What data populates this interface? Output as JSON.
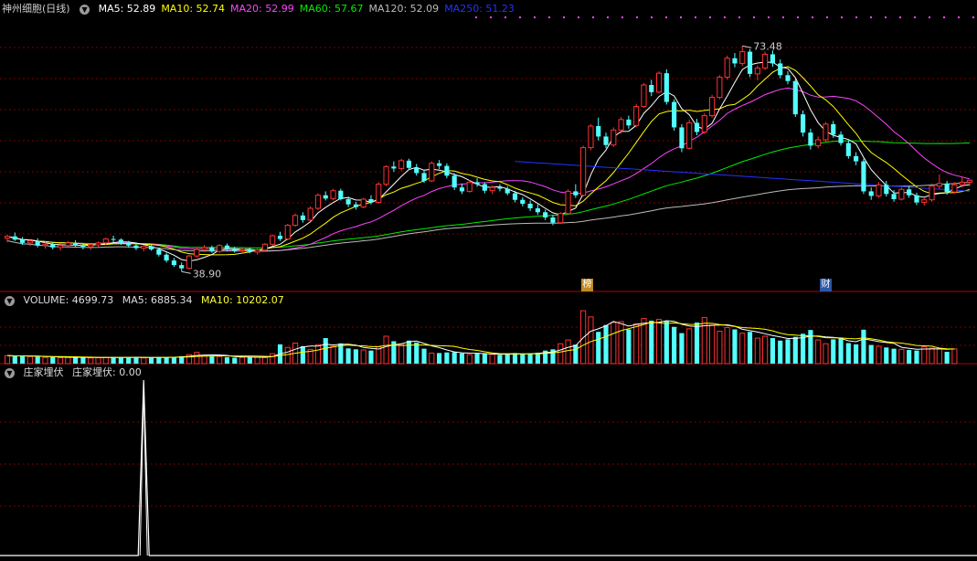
{
  "panel1": {
    "title": "神州细胞(日线)",
    "ma_labels": [
      {
        "text": "MA5: 52.89",
        "color": "#ffffff"
      },
      {
        "text": "MA10: 52.74",
        "color": "#ffff00"
      },
      {
        "text": "MA20: 52.99",
        "color": "#ff44ff"
      },
      {
        "text": "MA60: 57.67",
        "color": "#00ee00"
      },
      {
        "text": "MA120: 52.09",
        "color": "#bbbbbb"
      },
      {
        "text": "MA250: 51.23",
        "color": "#2233ff"
      }
    ],
    "high_label": "73.48",
    "low_label": "38.90",
    "marker_bang": "榜",
    "marker_cai": "财"
  },
  "panel2": {
    "title": "VOLUME: 4699.73",
    "ma5": "MA5: 6885.34",
    "ma10": "MA10: 10202.07"
  },
  "panel3": {
    "title": "庄家埋伏",
    "value_label": "庄家埋伏: 0.00"
  },
  "colors": {
    "up": "#ff3232",
    "down": "#54ffff",
    "grid": "#7a0000",
    "panel_border": "#b00000"
  },
  "icons": [
    "collapse-arrow-icon"
  ],
  "chart_data": [
    {
      "type": "candlestick",
      "title": "神州细胞(日线)",
      "ylim": [
        36,
        78
      ],
      "annotations": [
        {
          "text": "73.48",
          "value": 73.48
        },
        {
          "text": "38.90",
          "value": 38.9
        }
      ],
      "series": [
        {
          "name": "MA5",
          "value": 52.89
        },
        {
          "name": "MA10",
          "value": 52.74
        },
        {
          "name": "MA20",
          "value": 52.99
        },
        {
          "name": "MA60",
          "value": 57.67
        },
        {
          "name": "MA120",
          "value": 52.09
        },
        {
          "name": "MA250",
          "value": 51.23
        }
      ],
      "candles": [
        [
          44.0,
          44.6,
          43.4,
          44.3
        ],
        [
          44.3,
          44.9,
          43.6,
          43.8
        ],
        [
          43.8,
          44.2,
          43.0,
          43.3
        ],
        [
          43.3,
          43.9,
          42.8,
          43.6
        ],
        [
          43.6,
          44.0,
          42.6,
          42.9
        ],
        [
          42.9,
          43.5,
          42.4,
          43.1
        ],
        [
          43.1,
          43.4,
          42.3,
          42.6
        ],
        [
          42.6,
          43.2,
          42.1,
          42.9
        ],
        [
          42.9,
          43.6,
          42.5,
          43.3
        ],
        [
          43.3,
          43.7,
          42.7,
          42.9
        ],
        [
          42.9,
          43.3,
          42.3,
          42.7
        ],
        [
          42.7,
          43.2,
          42.2,
          43.0
        ],
        [
          43.0,
          43.5,
          42.6,
          43.3
        ],
        [
          43.3,
          44.1,
          43.0,
          43.9
        ],
        [
          43.9,
          44.4,
          43.4,
          43.8
        ],
        [
          43.8,
          44.0,
          43.0,
          43.3
        ],
        [
          43.3,
          43.6,
          42.6,
          42.9
        ],
        [
          42.9,
          43.3,
          42.2,
          42.5
        ],
        [
          42.5,
          43.0,
          42.0,
          42.8
        ],
        [
          42.8,
          43.1,
          42.1,
          42.3
        ],
        [
          42.3,
          42.6,
          41.2,
          41.5
        ],
        [
          41.5,
          41.8,
          40.3,
          40.6
        ],
        [
          40.6,
          41.0,
          39.6,
          39.9
        ],
        [
          39.9,
          40.3,
          38.9,
          39.4
        ],
        [
          39.4,
          41.5,
          39.2,
          41.3
        ],
        [
          41.3,
          42.6,
          41.0,
          42.3
        ],
        [
          42.3,
          43.0,
          41.9,
          42.6
        ],
        [
          42.6,
          42.9,
          41.8,
          42.0
        ],
        [
          42.0,
          43.1,
          41.8,
          42.9
        ],
        [
          42.9,
          43.2,
          42.0,
          42.4
        ],
        [
          42.4,
          42.7,
          41.8,
          42.1
        ],
        [
          42.1,
          42.5,
          41.6,
          42.3
        ],
        [
          42.3,
          42.6,
          41.7,
          41.9
        ],
        [
          41.9,
          42.4,
          41.5,
          42.2
        ],
        [
          42.2,
          43.3,
          42.0,
          43.1
        ],
        [
          43.1,
          44.6,
          42.9,
          44.4
        ],
        [
          44.4,
          45.0,
          43.6,
          43.9
        ],
        [
          43.9,
          46.2,
          43.7,
          46.0
        ],
        [
          46.0,
          47.8,
          45.8,
          47.5
        ],
        [
          47.5,
          48.0,
          46.4,
          46.8
        ],
        [
          46.8,
          48.9,
          46.6,
          48.6
        ],
        [
          48.6,
          50.9,
          48.3,
          50.6
        ],
        [
          50.6,
          51.2,
          49.8,
          50.1
        ],
        [
          50.1,
          51.6,
          49.8,
          51.3
        ],
        [
          51.3,
          51.6,
          49.8,
          50.0
        ],
        [
          50.0,
          50.4,
          48.8,
          49.2
        ],
        [
          49.2,
          49.6,
          48.4,
          48.8
        ],
        [
          48.8,
          50.2,
          48.6,
          50.0
        ],
        [
          50.0,
          50.6,
          49.2,
          49.5
        ],
        [
          49.5,
          52.6,
          49.3,
          52.3
        ],
        [
          52.3,
          55.2,
          52.0,
          55.0
        ],
        [
          55.0,
          55.8,
          54.2,
          54.7
        ],
        [
          54.7,
          56.2,
          54.3,
          55.9
        ],
        [
          55.9,
          56.2,
          54.5,
          54.8
        ],
        [
          54.8,
          55.4,
          53.6,
          54.0
        ],
        [
          54.0,
          54.5,
          52.5,
          52.8
        ],
        [
          52.8,
          55.8,
          52.6,
          55.5
        ],
        [
          55.5,
          56.0,
          54.6,
          55.1
        ],
        [
          55.1,
          55.5,
          53.2,
          53.6
        ],
        [
          53.6,
          54.0,
          51.4,
          51.8
        ],
        [
          51.8,
          52.4,
          50.8,
          51.2
        ],
        [
          51.2,
          52.9,
          51.0,
          52.6
        ],
        [
          52.6,
          53.2,
          51.9,
          52.3
        ],
        [
          52.3,
          52.6,
          50.9,
          51.3
        ],
        [
          51.3,
          52.1,
          50.8,
          51.8
        ],
        [
          51.8,
          52.3,
          51.2,
          51.6
        ],
        [
          51.6,
          52.0,
          50.6,
          50.9
        ],
        [
          50.9,
          51.3,
          49.5,
          49.9
        ],
        [
          49.9,
          50.3,
          48.9,
          49.3
        ],
        [
          49.3,
          49.8,
          48.2,
          48.6
        ],
        [
          48.6,
          49.2,
          47.6,
          48.0
        ],
        [
          48.0,
          48.4,
          46.8,
          47.2
        ],
        [
          47.2,
          47.6,
          46.0,
          46.4
        ],
        [
          46.4,
          48.0,
          46.2,
          47.8
        ],
        [
          47.8,
          51.5,
          47.6,
          51.2
        ],
        [
          51.2,
          52.3,
          50.2,
          50.6
        ],
        [
          50.6,
          58.2,
          50.4,
          57.9
        ],
        [
          57.9,
          61.5,
          57.5,
          61.2
        ],
        [
          61.2,
          62.5,
          59.0,
          59.6
        ],
        [
          59.6,
          60.2,
          57.8,
          58.3
        ],
        [
          58.3,
          61.0,
          58.0,
          60.6
        ],
        [
          60.6,
          62.6,
          60.0,
          62.2
        ],
        [
          62.2,
          62.8,
          60.8,
          61.3
        ],
        [
          61.3,
          64.6,
          61.0,
          64.2
        ],
        [
          64.2,
          67.8,
          64.0,
          67.5
        ],
        [
          67.5,
          68.3,
          65.8,
          66.4
        ],
        [
          66.4,
          69.6,
          66.2,
          69.3
        ],
        [
          69.3,
          69.9,
          64.5,
          64.9
        ],
        [
          64.9,
          65.3,
          60.5,
          61.0
        ],
        [
          61.0,
          61.5,
          57.2,
          57.8
        ],
        [
          57.8,
          62.2,
          57.6,
          61.7
        ],
        [
          61.7,
          62.3,
          59.8,
          60.3
        ],
        [
          60.3,
          63.2,
          60.0,
          62.8
        ],
        [
          62.8,
          66.0,
          62.5,
          65.6
        ],
        [
          65.6,
          69.0,
          65.3,
          68.7
        ],
        [
          68.7,
          72.0,
          68.3,
          71.6
        ],
        [
          71.6,
          72.4,
          70.2,
          70.8
        ],
        [
          70.8,
          73.48,
          70.4,
          72.6
        ],
        [
          72.6,
          73.0,
          68.7,
          69.2
        ],
        [
          69.2,
          70.5,
          68.2,
          70.1
        ],
        [
          70.1,
          72.6,
          69.8,
          72.2
        ],
        [
          72.2,
          72.8,
          70.3,
          70.8
        ],
        [
          70.8,
          71.4,
          68.5,
          69.0
        ],
        [
          69.0,
          69.6,
          67.6,
          68.1
        ],
        [
          68.1,
          68.5,
          62.6,
          63.0
        ],
        [
          63.0,
          63.6,
          59.6,
          60.2
        ],
        [
          60.2,
          60.8,
          57.6,
          58.2
        ],
        [
          58.2,
          59.6,
          57.8,
          59.1
        ],
        [
          59.1,
          61.8,
          58.8,
          61.5
        ],
        [
          61.5,
          62.0,
          59.4,
          59.9
        ],
        [
          59.9,
          60.4,
          58.2,
          58.6
        ],
        [
          58.6,
          59.0,
          56.2,
          56.6
        ],
        [
          56.6,
          57.2,
          55.2,
          55.8
        ],
        [
          55.8,
          56.2,
          50.8,
          51.2
        ],
        [
          51.2,
          51.8,
          49.9,
          50.5
        ],
        [
          50.5,
          52.6,
          50.2,
          52.2
        ],
        [
          52.2,
          52.8,
          50.4,
          50.8
        ],
        [
          50.8,
          51.4,
          49.6,
          50.0
        ],
        [
          50.0,
          51.8,
          49.8,
          51.5
        ],
        [
          51.5,
          52.0,
          50.2,
          50.6
        ],
        [
          50.6,
          51.0,
          49.1,
          49.5
        ],
        [
          49.5,
          50.3,
          49.0,
          49.9
        ],
        [
          49.9,
          52.4,
          49.6,
          52.0
        ],
        [
          52.0,
          53.8,
          51.6,
          52.4
        ],
        [
          52.4,
          52.8,
          50.7,
          51.1
        ],
        [
          51.1,
          52.6,
          50.9,
          52.2
        ],
        [
          52.2,
          53.4,
          51.8,
          52.6
        ],
        [
          52.6,
          53.0,
          52.0,
          52.9
        ]
      ],
      "volume": [
        2600,
        2400,
        2500,
        2300,
        2200,
        2000,
        2100,
        1900,
        2000,
        2100,
        1950,
        1850,
        1900,
        2000,
        2150,
        2100,
        2000,
        1950,
        1850,
        2000,
        2150,
        2050,
        2200,
        2400,
        2900,
        3600,
        2700,
        2500,
        2300,
        2100,
        1900,
        2000,
        2200,
        2100,
        2000,
        3200,
        6200,
        5200,
        6600,
        5600,
        4600,
        6100,
        8200,
        5600,
        6500,
        4900,
        4600,
        4400,
        4200,
        5400,
        8800,
        7200,
        6200,
        7400,
        6800,
        4800,
        3400,
        3400,
        3600,
        3700,
        3300,
        2900,
        3200,
        3100,
        3000,
        2800,
        3100,
        3400,
        3200,
        3300,
        3500,
        4200,
        4600,
        6400,
        7600,
        6100,
        17000,
        15000,
        10200,
        12400,
        13200,
        13500,
        11000,
        12800,
        14500,
        13800,
        14200,
        13600,
        11800,
        9800,
        11200,
        13200,
        14800,
        12400,
        10400,
        11600,
        11000,
        9800,
        10200,
        8200,
        8800,
        8200,
        7400,
        7800,
        8600,
        9600,
        10800,
        7600,
        6400,
        7800,
        8200,
        6600,
        6200,
        10900,
        6000,
        5600,
        5200,
        4800,
        4600,
        4400,
        4200,
        5400,
        5000,
        4700,
        3800,
        4699.73
      ]
    },
    {
      "type": "line",
      "title": "庄家埋伏",
      "series": [
        {
          "name": "庄家埋伏",
          "value": 0.0,
          "peaks": [
            {
              "x": 18,
              "y": 1.0
            }
          ]
        }
      ]
    }
  ]
}
